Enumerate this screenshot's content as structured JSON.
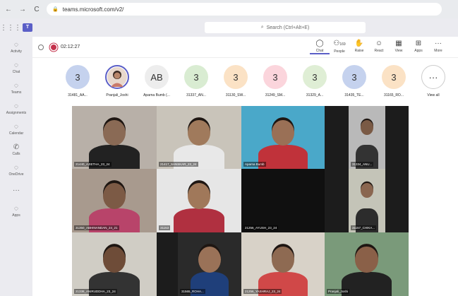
{
  "browser": {
    "url": "teams.microsoft.com/v2/"
  },
  "teams": {
    "search_placeholder": "Search (Ctrl+Alt+E)",
    "logo_text": "T"
  },
  "rail": [
    {
      "label": "Activity",
      "icon": "bell-icon"
    },
    {
      "label": "Chat",
      "icon": "chat-icon"
    },
    {
      "label": "Teams",
      "icon": "teams-icon"
    },
    {
      "label": "Assignments",
      "icon": "assignments-icon"
    },
    {
      "label": "Calendar",
      "icon": "calendar-icon"
    },
    {
      "label": "Calls",
      "icon": "phone-icon"
    },
    {
      "label": "OneDrive",
      "icon": "cloud-icon"
    },
    {
      "label": "",
      "icon": "more-icon"
    },
    {
      "label": "Apps",
      "icon": "apps-icon"
    }
  ],
  "meeting": {
    "timer": "02:12:27",
    "controls": [
      {
        "label": "Chat",
        "icon": "chat-icon"
      },
      {
        "label": "People",
        "icon": "people-icon",
        "count": "169"
      },
      {
        "label": "Raise",
        "icon": "hand-icon"
      },
      {
        "label": "React",
        "icon": "smile-icon"
      },
      {
        "label": "View",
        "icon": "grid-icon"
      },
      {
        "label": "Apps",
        "icon": "apps-icon"
      },
      {
        "label": "More",
        "icon": "more-icon"
      }
    ]
  },
  "participants": [
    {
      "name": "31481_AA...",
      "initials": "3",
      "color": "#c5d2ee"
    },
    {
      "name": "Pranjali_Joshi",
      "initials": "",
      "color": "#ffffff"
    },
    {
      "name": "Aparna Bumb (...",
      "initials": "AB",
      "color": "#ededed"
    },
    {
      "name": "31337_AN...",
      "initials": "3",
      "color": "#d9ecd2"
    },
    {
      "name": "31130_SW...",
      "initials": "3",
      "color": "#fbe2c5"
    },
    {
      "name": "31249_SM...",
      "initials": "3",
      "color": "#fbd5dc"
    },
    {
      "name": "31329_A...",
      "initials": "3",
      "color": "#dfeed5"
    },
    {
      "name": "31435_TE...",
      "initials": "3",
      "color": "#c5d2ee"
    },
    {
      "name": "31165_RO...",
      "initials": "3",
      "color": "#fbe2c5"
    },
    {
      "name": "View all",
      "initials": "···",
      "color": "#ffffff"
    }
  ],
  "tiles": [
    {
      "label": "21440_AJIETHA_23_24",
      "bg": "#b8b0a8",
      "skin": "#8a6a55",
      "shirt": "#222"
    },
    {
      "label": "21417_SANSKAR_23_24",
      "bg": "#c9c4ba",
      "skin": "#a07a5c",
      "shirt": "#e8e8e8"
    },
    {
      "label": "Aparna Bumb",
      "bg": "#4aa8c9",
      "skin": "#9a7056",
      "shirt": "#c0323a"
    },
    {
      "label": "31334_ANU...",
      "bg": "#b9b9b9",
      "skin": "#7a5a45",
      "shirt": "#333"
    },
    {
      "label": "31350_ABHINANDAN_24_21",
      "bg": "#a89a8e",
      "skin": "#7c5a45",
      "shirt": "#b8446a"
    },
    {
      "label": "31153",
      "bg": "#e6e6e6",
      "skin": "#a0785a",
      "shirt": "#b03040"
    },
    {
      "label": "21256_AYUSH_23_24",
      "bg": "#101010",
      "skin": "#101010",
      "shirt": "#101010"
    },
    {
      "label": "31157_CHIKA...",
      "bg": "#c4c4b8",
      "skin": "#8a6650",
      "shirt": "#2c2c2c"
    },
    {
      "label": "21338_ANIRUDDHA_23_24",
      "bg": "#d0cdc5",
      "skin": "#6e4c38",
      "shirt": "#333"
    },
    {
      "label": "31565_ROHA...",
      "bg": "#2a2a2a",
      "skin": "#9a7258",
      "shirt": "#1f3f7a"
    },
    {
      "label": "21256_YASHRAJ_23_24",
      "bg": "#d8d2c8",
      "skin": "#8e6a52",
      "shirt": "#d04848"
    },
    {
      "label": "Pranjali_Joshi",
      "bg": "#7a9a7a",
      "skin": "#8a6048",
      "shirt": "#222"
    }
  ]
}
